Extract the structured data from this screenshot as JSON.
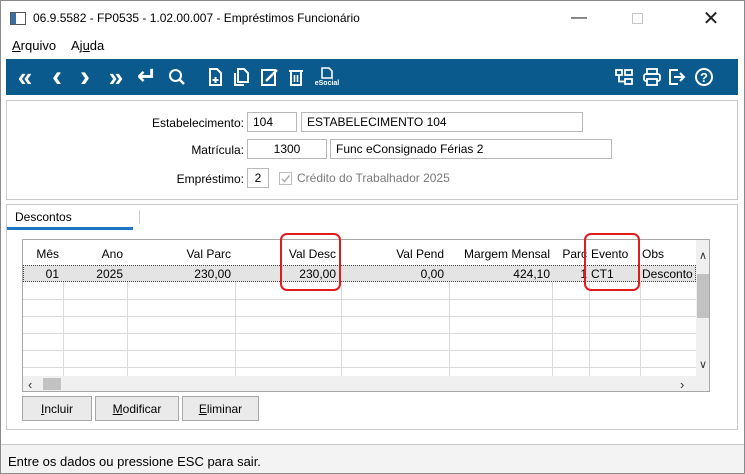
{
  "window": {
    "title": "06.9.5582 - FP0535 - 1.02.00.007 - Empréstimos Funcionário",
    "minimize": "—",
    "close": "✕"
  },
  "menu": {
    "arquivo": {
      "first": "A",
      "rest": "rquivo"
    },
    "ajuda": {
      "pre": "Aj",
      "u": "u",
      "post": "da"
    }
  },
  "toolbar": {
    "icons": {
      "first": "«",
      "prev": "‹",
      "next": "›",
      "last": "»",
      "goto": "↵",
      "search": "search-icon",
      "new": "new-icon",
      "copy": "copy-icon",
      "edit": "edit-icon",
      "delete": "delete-icon",
      "esocial_label": "eSocial",
      "tree": "tree-icon",
      "print": "print-icon",
      "exit": "exit-icon",
      "help": "?"
    },
    "color": "#0b5a8e"
  },
  "form": {
    "estabelecimento_label": "Estabelecimento:",
    "estabelecimento_code": "104",
    "estabelecimento_name": "ESTABELECIMENTO 104",
    "matricula_label": "Matrícula:",
    "matricula_code": "1300",
    "matricula_name": "Func eConsignado Férias 2",
    "emprestimo_label": "Empréstimo:",
    "emprestimo_value": "2",
    "credito_label": "Crédito do Trabalhador 2025"
  },
  "tabs": {
    "descontos": "Descontos"
  },
  "grid": {
    "columns": {
      "mes": "Mês",
      "ano": "Ano",
      "val_parc": "Val Parc",
      "val_desc": "Val Desc",
      "val_pend": "Val Pend",
      "margem": "Margem Mensal",
      "parc": "Parc",
      "evento": "Evento",
      "obs": "Obs"
    },
    "rows": [
      {
        "mes": "01",
        "ano": "2025",
        "val_parc": "230,00",
        "val_desc": "230,00",
        "val_pend": "0,00",
        "margem": "424,10",
        "parc": "1",
        "evento": "CT1",
        "obs": "Desconto"
      }
    ]
  },
  "buttons": {
    "incluir": {
      "u": "I",
      "rest": "ncluir"
    },
    "modificar": {
      "u": "M",
      "rest": "odificar"
    },
    "eliminar": {
      "u": "E",
      "rest": "liminar"
    }
  },
  "status": {
    "text": "Entre os dados ou pressione ESC para sair."
  },
  "colors": {
    "highlight": "#e01b1b",
    "tab_accent": "#1c76c5"
  }
}
